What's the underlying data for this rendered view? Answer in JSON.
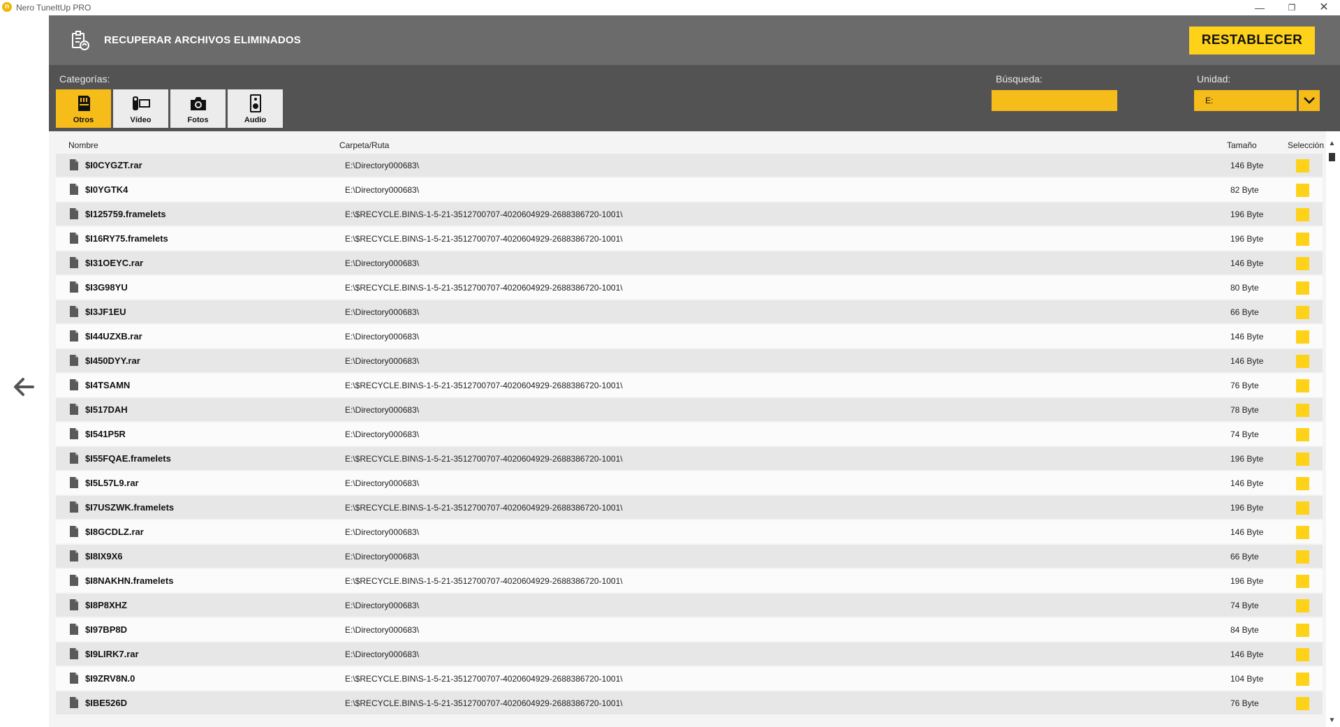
{
  "window": {
    "title": "Nero TuneItUp PRO",
    "logo_letter": "n",
    "minimize": "—",
    "maximize": "❐",
    "close": "✕"
  },
  "header": {
    "title": "RECUPERAR ARCHIVOS ELIMINADOS",
    "restore_label": "RESTABLECER"
  },
  "filters": {
    "categories_label": "Categorías:",
    "categories": [
      {
        "label": "Otros",
        "icon": "sd-card-icon",
        "active": true
      },
      {
        "label": "Vídeo",
        "icon": "video-camera-icon",
        "active": false
      },
      {
        "label": "Fotos",
        "icon": "camera-icon",
        "active": false
      },
      {
        "label": "Audio",
        "icon": "speaker-icon",
        "active": false
      }
    ],
    "search_label": "Búsqueda:",
    "search_value": "",
    "drive_label": "Unidad:",
    "drive_value": "E:"
  },
  "columns": {
    "name": "Nombre",
    "path": "Carpeta/Ruta",
    "size": "Tamaño",
    "selection": "Selección"
  },
  "files": [
    {
      "name": "$I0CYGZT.rar",
      "path": "E:\\Directory000683\\",
      "size": "146 Byte"
    },
    {
      "name": "$I0YGTK4",
      "path": "E:\\Directory000683\\",
      "size": "82 Byte"
    },
    {
      "name": "$I125759.framelets",
      "path": "E:\\$RECYCLE.BIN\\S-1-5-21-3512700707-4020604929-2688386720-1001\\",
      "size": "196 Byte"
    },
    {
      "name": "$I16RY75.framelets",
      "path": "E:\\$RECYCLE.BIN\\S-1-5-21-3512700707-4020604929-2688386720-1001\\",
      "size": "196 Byte"
    },
    {
      "name": "$I31OEYC.rar",
      "path": "E:\\Directory000683\\",
      "size": "146 Byte"
    },
    {
      "name": "$I3G98YU",
      "path": "E:\\$RECYCLE.BIN\\S-1-5-21-3512700707-4020604929-2688386720-1001\\",
      "size": "80 Byte"
    },
    {
      "name": "$I3JF1EU",
      "path": "E:\\Directory000683\\",
      "size": "66 Byte"
    },
    {
      "name": "$I44UZXB.rar",
      "path": "E:\\Directory000683\\",
      "size": "146 Byte"
    },
    {
      "name": "$I450DYY.rar",
      "path": "E:\\Directory000683\\",
      "size": "146 Byte"
    },
    {
      "name": "$I4TSAMN",
      "path": "E:\\$RECYCLE.BIN\\S-1-5-21-3512700707-4020604929-2688386720-1001\\",
      "size": "76 Byte"
    },
    {
      "name": "$I517DAH",
      "path": "E:\\Directory000683\\",
      "size": "78 Byte"
    },
    {
      "name": "$I541P5R",
      "path": "E:\\Directory000683\\",
      "size": "74 Byte"
    },
    {
      "name": "$I55FQAE.framelets",
      "path": "E:\\$RECYCLE.BIN\\S-1-5-21-3512700707-4020604929-2688386720-1001\\",
      "size": "196 Byte"
    },
    {
      "name": "$I5L57L9.rar",
      "path": "E:\\Directory000683\\",
      "size": "146 Byte"
    },
    {
      "name": "$I7USZWK.framelets",
      "path": "E:\\$RECYCLE.BIN\\S-1-5-21-3512700707-4020604929-2688386720-1001\\",
      "size": "196 Byte"
    },
    {
      "name": "$I8GCDLZ.rar",
      "path": "E:\\Directory000683\\",
      "size": "146 Byte"
    },
    {
      "name": "$I8IX9X6",
      "path": "E:\\Directory000683\\",
      "size": "66 Byte"
    },
    {
      "name": "$I8NAKHN.framelets",
      "path": "E:\\$RECYCLE.BIN\\S-1-5-21-3512700707-4020604929-2688386720-1001\\",
      "size": "196 Byte"
    },
    {
      "name": "$I8P8XHZ",
      "path": "E:\\Directory000683\\",
      "size": "74 Byte"
    },
    {
      "name": "$I97BP8D",
      "path": "E:\\Directory000683\\",
      "size": "84 Byte"
    },
    {
      "name": "$I9LIRK7.rar",
      "path": "E:\\Directory000683\\",
      "size": "146 Byte"
    },
    {
      "name": "$I9ZRV8N.0",
      "path": "E:\\$RECYCLE.BIN\\S-1-5-21-3512700707-4020604929-2688386720-1001\\",
      "size": "104 Byte"
    },
    {
      "name": "$IBE526D",
      "path": "E:\\$RECYCLE.BIN\\S-1-5-21-3512700707-4020604929-2688386720-1001\\",
      "size": "76 Byte"
    }
  ],
  "colors": {
    "accent": "#ffd21a",
    "accent_dark": "#f6bc1a",
    "header_bg": "#6b6b6b",
    "filter_bg": "#535353"
  }
}
